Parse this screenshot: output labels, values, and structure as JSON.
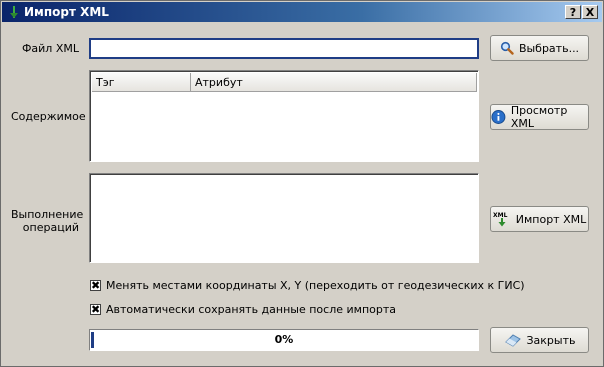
{
  "window": {
    "title": "Импорт XML",
    "help_glyph": "?",
    "close_glyph": "X"
  },
  "xml_file": {
    "label": "Файл XML",
    "value": "",
    "browse_label": "Выбрать..."
  },
  "content": {
    "label": "Содержимое",
    "columns": [
      "Тэг",
      "Атрибут"
    ],
    "view_button_label": "Просмотр XML"
  },
  "operations": {
    "label_line1": "Выполнение",
    "label_line2": "операций",
    "import_button_label": "Импорт XML",
    "import_icon_text": "XML"
  },
  "options": [
    {
      "label": "Менять местами координаты X, Y (переходить от геодезических к ГИС)",
      "checked": true,
      "mark": "✖"
    },
    {
      "label": "Автоматически сохранять данные после импорта",
      "checked": true,
      "mark": "✖"
    }
  ],
  "progress": {
    "percent": 0,
    "text": "0%"
  },
  "close_button_label": "Закрыть",
  "icons": {
    "browse": "magnifier-icon",
    "view": "info-icon",
    "import": "xml-import-icon",
    "close": "eraser-icon",
    "title": "app-icon"
  },
  "colors": {
    "titlebar_start": "#0a246a",
    "titlebar_end": "#a6caf0",
    "progress_fill": "#1f3d85",
    "info_blue": "#2a6fc9"
  }
}
